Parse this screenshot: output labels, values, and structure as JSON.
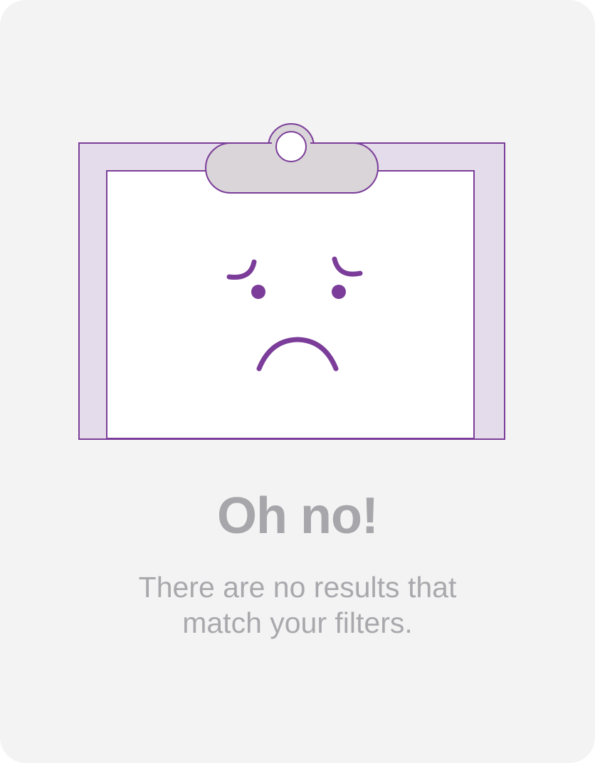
{
  "empty_state": {
    "title": "Oh no!",
    "message": "There are no results that match your filters.",
    "illustration": "sad-clipboard-icon"
  },
  "colors": {
    "background": "#f3f3f3",
    "accent": "#7b3d99",
    "frame_fill": "#e4dcea",
    "clip_fill": "#d9d5d8",
    "text": "#a8a8ac"
  }
}
